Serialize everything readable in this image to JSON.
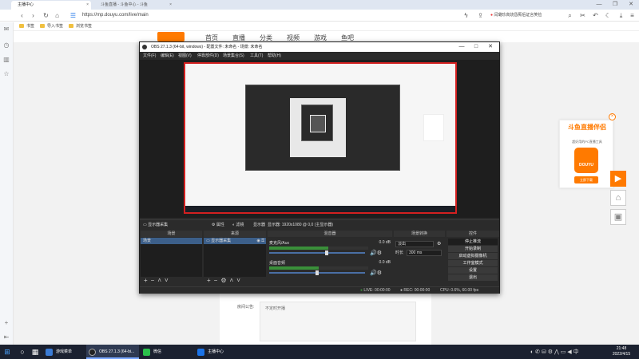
{
  "browser": {
    "tabs": [
      {
        "label": "主播中心",
        "active": true
      },
      {
        "label": "斗鱼直播 - 斗鱼中心 - 斗鱼",
        "active": false
      }
    ],
    "url": "https://mp.douyu.com/live/main",
    "search_text": "闫璐珍高烧昏厥后证言笑捡",
    "bookmarks": [
      "书签",
      "导入书签",
      "浏览书签"
    ],
    "window_controls": [
      "—",
      "❐",
      "✕"
    ]
  },
  "site": {
    "nav_items": [
      "首页",
      "直播",
      "分类",
      "视频",
      "游戏",
      "鱼吧"
    ],
    "badges": {
      "video": "3",
      "game": "1"
    },
    "notice_label": "房间公告:",
    "notice_text": "不定时开播"
  },
  "promo": {
    "title": "斗鱼直播伴侣",
    "subtitle": "超好用的PC直播工具",
    "logo_text": "DOUYU",
    "button": "立即下载",
    "accent": "#ff7a00"
  },
  "obs": {
    "title": "OBS 27.1.3 (64-bit, windows) - 配置文件: 未命名 - 场景: 未命名",
    "menu": [
      "文件(F)",
      "编辑(E)",
      "视图(V)",
      "停靠部件(D)",
      "场景集合(S)",
      "工具(T)",
      "帮助(H)"
    ],
    "toolbar": {
      "source": "显示器采集",
      "properties": "属性",
      "filters": "滤镜",
      "display_label": "显示器",
      "display_value": "显示器: 1920x1080 @ 0,0 (主显示器)"
    },
    "docks": {
      "scenes": {
        "title": "场景",
        "items": [
          "场景"
        ]
      },
      "sources": {
        "title": "来源",
        "items": [
          "显示器采集"
        ]
      },
      "mixer": {
        "title": "混音器",
        "channels": [
          {
            "name": "麦克风/Aux",
            "db": "0.0 dB",
            "level": 0.6
          },
          {
            "name": "桌面音频",
            "db": "0.0 dB",
            "level": 0.5
          }
        ]
      },
      "transitions": {
        "title": "场景转换",
        "type": "淡出",
        "duration_label": "时长",
        "duration": "300 ms"
      },
      "controls": {
        "title": "控件",
        "buttons": [
          "停止推流",
          "开始录制",
          "启动虚拟摄像机",
          "工作室模式",
          "设置",
          "退出"
        ]
      }
    },
    "status": {
      "live": "LIVE: 00:00:00",
      "rec": "REC: 00:00:00",
      "cpu": "CPU: 0.6%, 60.00 fps"
    }
  },
  "taskbar": {
    "apps": [
      "游戏菜单",
      "OBS 27.1.3 (64-bi...",
      "微信",
      "主播中心"
    ],
    "time": "21:48",
    "date": "2022/4/15"
  }
}
